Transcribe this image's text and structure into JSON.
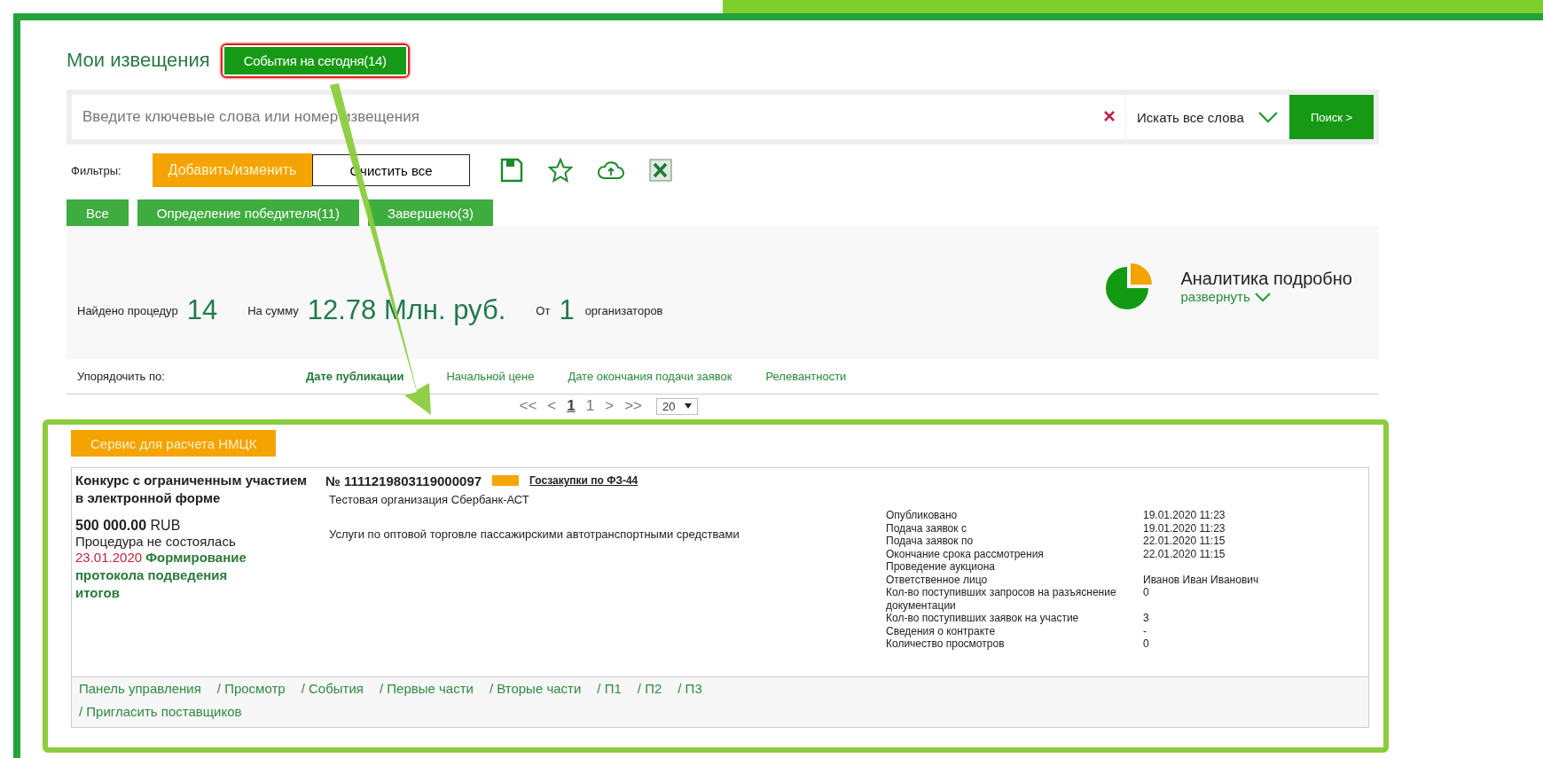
{
  "header": {
    "title": "Мои извещения",
    "events_button": "События на сегодня(14)"
  },
  "search": {
    "placeholder": "Введите ключевые слова или номер извещения",
    "mode": "Искать все слова",
    "button": "Поиск >"
  },
  "filters": {
    "label": "Фильтры:",
    "add_button": "Добавить/изменить",
    "clear_button": "Очистить все"
  },
  "status_tabs": [
    {
      "label": "Все"
    },
    {
      "label": "Определение победителя(11)"
    },
    {
      "label": "Завершено(3)"
    }
  ],
  "stats": [
    {
      "label": "Найдено процедур",
      "value": "14"
    },
    {
      "label": "На сумму",
      "value": "12.78 Млн. руб."
    },
    {
      "label": "От",
      "value": "1",
      "note": "организаторов"
    }
  ],
  "analytics": {
    "title": "Аналитика подробно",
    "expand": "развернуть"
  },
  "sort": {
    "label": "Упорядочить по:",
    "options": [
      {
        "label": "Дате публикации",
        "selected": true
      },
      {
        "label": "Начальной цене",
        "selected": false
      },
      {
        "label": "Дате окончания подачи заявок",
        "selected": false
      },
      {
        "label": "Релевантности",
        "selected": false
      }
    ]
  },
  "pagination": {
    "items": [
      {
        "label": "<<",
        "selected": false
      },
      {
        "label": "<",
        "selected": false
      },
      {
        "label": "1",
        "selected": true
      },
      {
        "label": "1",
        "selected": false
      },
      {
        "label": ">",
        "selected": false
      },
      {
        "label": ">>",
        "selected": false
      }
    ],
    "page_size": "20"
  },
  "nmck_button": "Сервис для расчета НМЦК",
  "card": {
    "title": "Конкурс с ограниченным участием в электронной форме",
    "number": "№ 1111219803119000097",
    "law_tag": {
      "label": "Госзакупки по ФЗ-44",
      "color": "#f5a600"
    },
    "price": "500 000.00",
    "currency": "RUB",
    "status": "Процедура не состоялась",
    "event_date": "23.01.2020",
    "event": "Формирование протокола подведения итогов",
    "organization": "Тестовая организация Сбербанк-АСТ",
    "subject": "Услуги по оптовой торговле пассажирскими автотранспортными средствами",
    "details": [
      {
        "label": "Опубликовано",
        "value": "19.01.2020 11:23"
      },
      {
        "label": "Подача заявок с",
        "value": "19.01.2020 11:23"
      },
      {
        "label": "Подача заявок по",
        "value": "22.01.2020 11:15"
      },
      {
        "label": "Окончание срока рассмотрения",
        "value": "22.01.2020 11:15"
      },
      {
        "label": "Проведение аукциона"
      },
      {
        "label": "Ответственное лицо",
        "value": "Иванов Иван Иванович"
      },
      {
        "label": "Кол-во поступивших запросов на разъяснение документации",
        "value": "0"
      },
      {
        "label": "Кол-во поступивших заявок на участие",
        "value": "3"
      },
      {
        "label": "Сведения о контракте",
        "value": "-"
      },
      {
        "label": "Количество просмотров",
        "value": "0"
      }
    ],
    "links": [
      "Панель управления",
      "/ Просмотр",
      "/ События",
      "/ Первые части",
      "/ Вторые части",
      "/ П1",
      "/ П2",
      "/ П3",
      "/ Пригласить поставщиков"
    ]
  }
}
